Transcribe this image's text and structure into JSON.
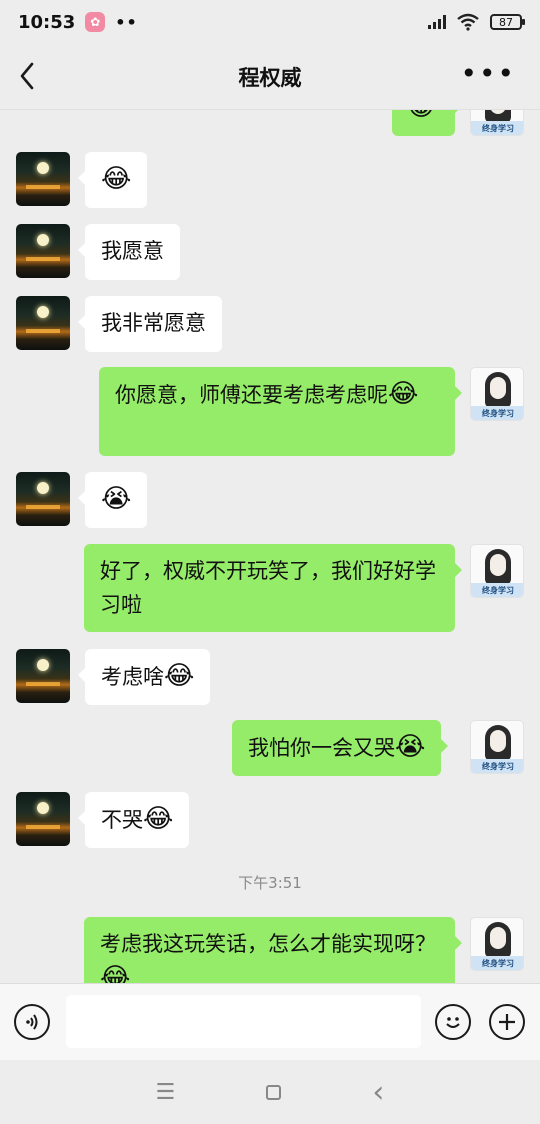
{
  "status_bar": {
    "time": "10:53",
    "dots": "••",
    "battery": "87"
  },
  "header": {
    "title": "程权威",
    "back_icon": "chevron-left-icon",
    "more_label": "•••"
  },
  "messages": [
    {
      "side": "right",
      "text": "",
      "emoji": "😂",
      "partial": true
    },
    {
      "side": "left",
      "text": "",
      "emoji": "😂"
    },
    {
      "side": "left",
      "text": "我愿意",
      "emoji": ""
    },
    {
      "side": "left",
      "text": "我非常愿意",
      "emoji": ""
    },
    {
      "side": "right",
      "text": "你愿意，师傅还要考虑考虑呢",
      "emoji": "😂"
    },
    {
      "side": "left",
      "text": "",
      "emoji": "😭"
    },
    {
      "side": "right",
      "text": "好了，权威不开玩笑了，我们好好学习啦",
      "emoji": ""
    },
    {
      "side": "left",
      "text": "考虑啥",
      "emoji": "😂"
    },
    {
      "side": "right",
      "text": "我怕你一会又哭",
      "emoji": "😭"
    },
    {
      "side": "left",
      "text": "不哭",
      "emoji": "😂"
    },
    {
      "side": "right",
      "text": "考虑我这玩笑话，怎么才能实现呀？",
      "emoji": "😂"
    }
  ],
  "timestamp": "下午3:51",
  "avatar_tag": "终身学习",
  "input_bar": {
    "voice_icon": "voice-icon",
    "emoji_icon": "emoji-icon",
    "plus_icon": "plus-icon",
    "input_value": ""
  },
  "nav_bar": {
    "menu_glyph": "☰",
    "back_glyph": "‹"
  }
}
